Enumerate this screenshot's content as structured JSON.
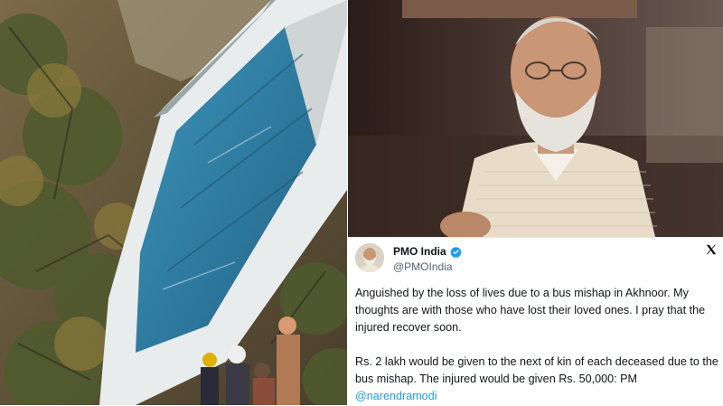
{
  "tweet": {
    "display_name": "PMO India",
    "handle": "@PMOIndia",
    "paragraph_1": "Anguished by the loss of lives due to a bus mishap in Akhnoor. My thoughts are with those who have lost their loved ones. I pray that the injured recover soon.",
    "paragraph_2_text": "Rs. 2 lakh would be given to the next of kin of each deceased due to the bus mishap. The injured would be given Rs. 50,000: PM ",
    "mention": "@narendramodi",
    "verified_icon": "verified-badge-icon",
    "platform_icon": "x-logo-icon"
  },
  "colors": {
    "link": "#1d9bf0",
    "verified": "#1d9bf0",
    "bus_body": "#2f7fa6"
  }
}
